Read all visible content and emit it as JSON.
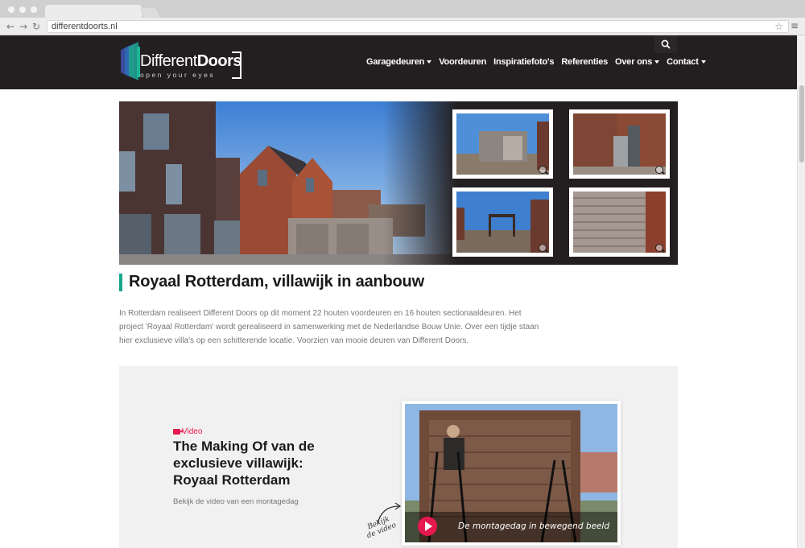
{
  "browser": {
    "url": "differentdoorts.nl",
    "back_icon": "←",
    "forward_icon": "→",
    "reload_icon": "↻",
    "star_icon": "☆",
    "menu_icon": "≡"
  },
  "header": {
    "logo_different": "Different",
    "logo_doors": "Doors",
    "logo_tagline": "open your eyes",
    "search_icon": "⌕",
    "nav": [
      {
        "label": "Garagedeuren",
        "dropdown": true
      },
      {
        "label": "Voordeuren",
        "dropdown": false
      },
      {
        "label": "Inspiratiefoto's",
        "dropdown": false
      },
      {
        "label": "Referenties",
        "dropdown": false
      },
      {
        "label": "Over ons",
        "dropdown": true
      },
      {
        "label": "Contact",
        "dropdown": true
      }
    ]
  },
  "article": {
    "title": "Royaal Rotterdam, villawijk in aanbouw",
    "intro": "In Rotterdam realiseert Different Doors op dit moment 22 houten voordeuren en 16 houten sectionaaldeuren. Het project 'Royaal Rotterdam' wordt gerealiseerd in samenwerking met de Nederlandse Bouw Unie. Over een tijdje staan hier exclusieve villa's op een schitterende locatie. Voorzien van mooie deuren van Different Doors."
  },
  "video": {
    "label": "Video",
    "title": "The Making Of van de exclusieve villawijk: Royaal Rotterdam",
    "subtitle": "Bekijk de video van een montagedag",
    "caption": "De montagedag in bewegend beeld",
    "handwritten_line1": "Bekijk",
    "handwritten_line2": "de video"
  },
  "colors": {
    "accent_green": "#16a68b",
    "accent_red": "#e5194e",
    "header_bg": "#231f20"
  }
}
